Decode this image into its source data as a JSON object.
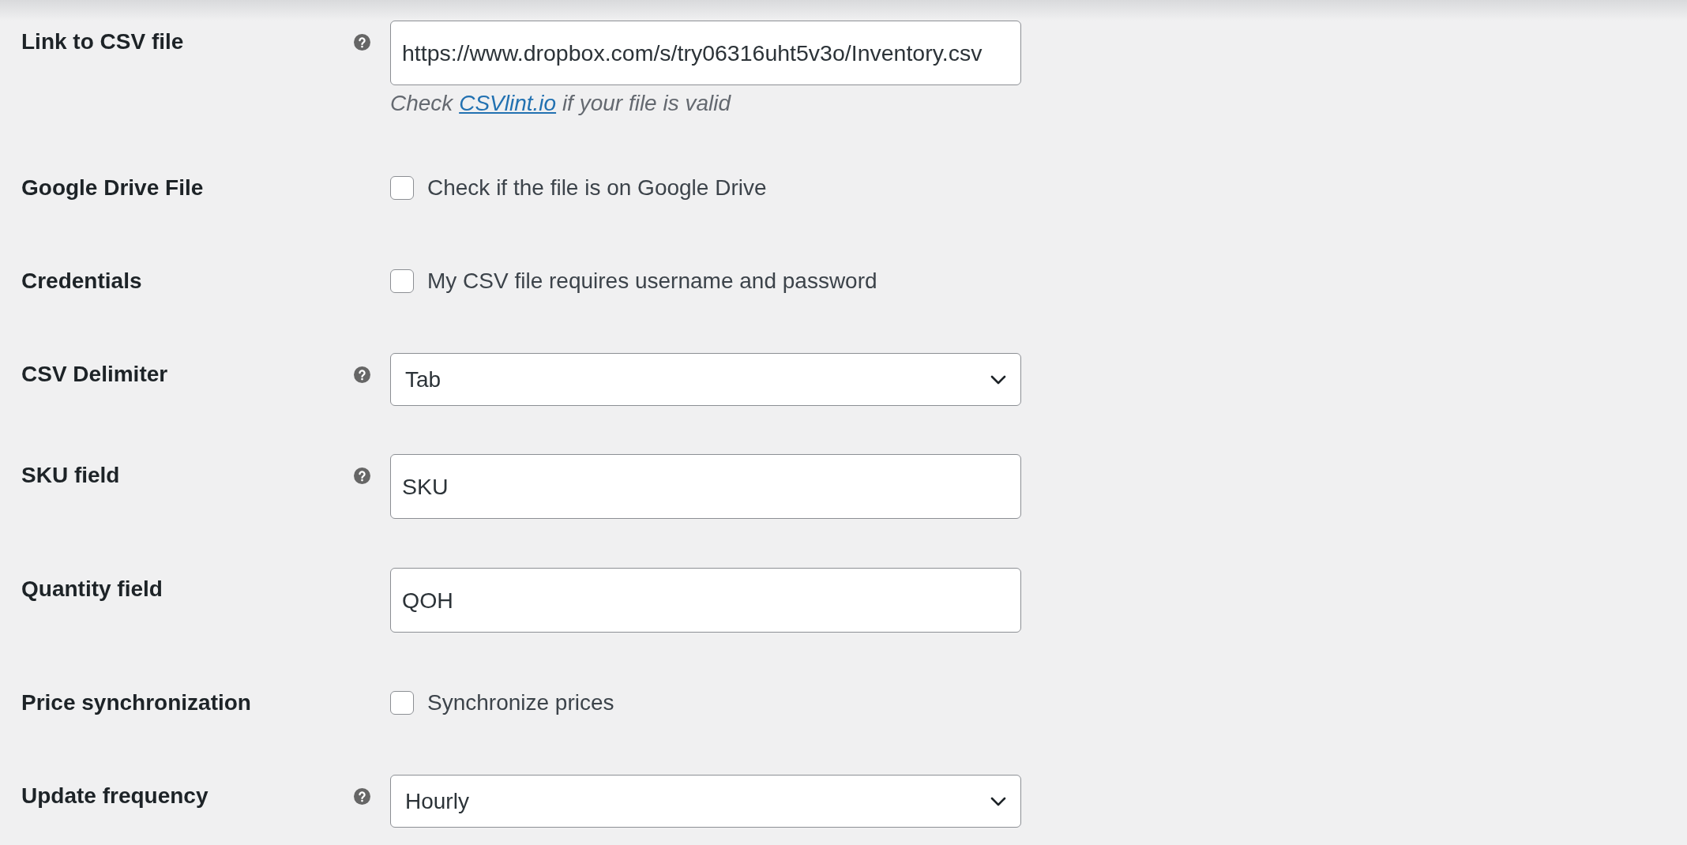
{
  "settings": [
    {
      "kind": "text",
      "label": "Link to CSV file",
      "help": true,
      "value": "https://www.dropbox.com/s/try06316uht5v3o/Inventory.csv",
      "description": {
        "before": "Check",
        "link": "CSVlint.io",
        "after": "if your file is valid"
      }
    },
    {
      "kind": "checkbox",
      "label": "Google Drive File",
      "help": false,
      "checked": false,
      "option": "Check if the file is on Google Drive"
    },
    {
      "kind": "checkbox",
      "label": "Credentials",
      "help": false,
      "checked": false,
      "option": "My CSV file requires username and password"
    },
    {
      "kind": "select",
      "label": "CSV Delimiter",
      "help": true,
      "value": "Tab"
    },
    {
      "kind": "text",
      "label": "SKU field",
      "help": true,
      "value": "SKU"
    },
    {
      "kind": "text",
      "label": "Quantity field",
      "help": false,
      "value": "QOH"
    },
    {
      "kind": "checkbox",
      "label": "Price synchronization",
      "help": false,
      "checked": false,
      "option": "Synchronize prices"
    },
    {
      "kind": "select",
      "label": "Update frequency",
      "help": true,
      "value": "Hourly"
    }
  ]
}
